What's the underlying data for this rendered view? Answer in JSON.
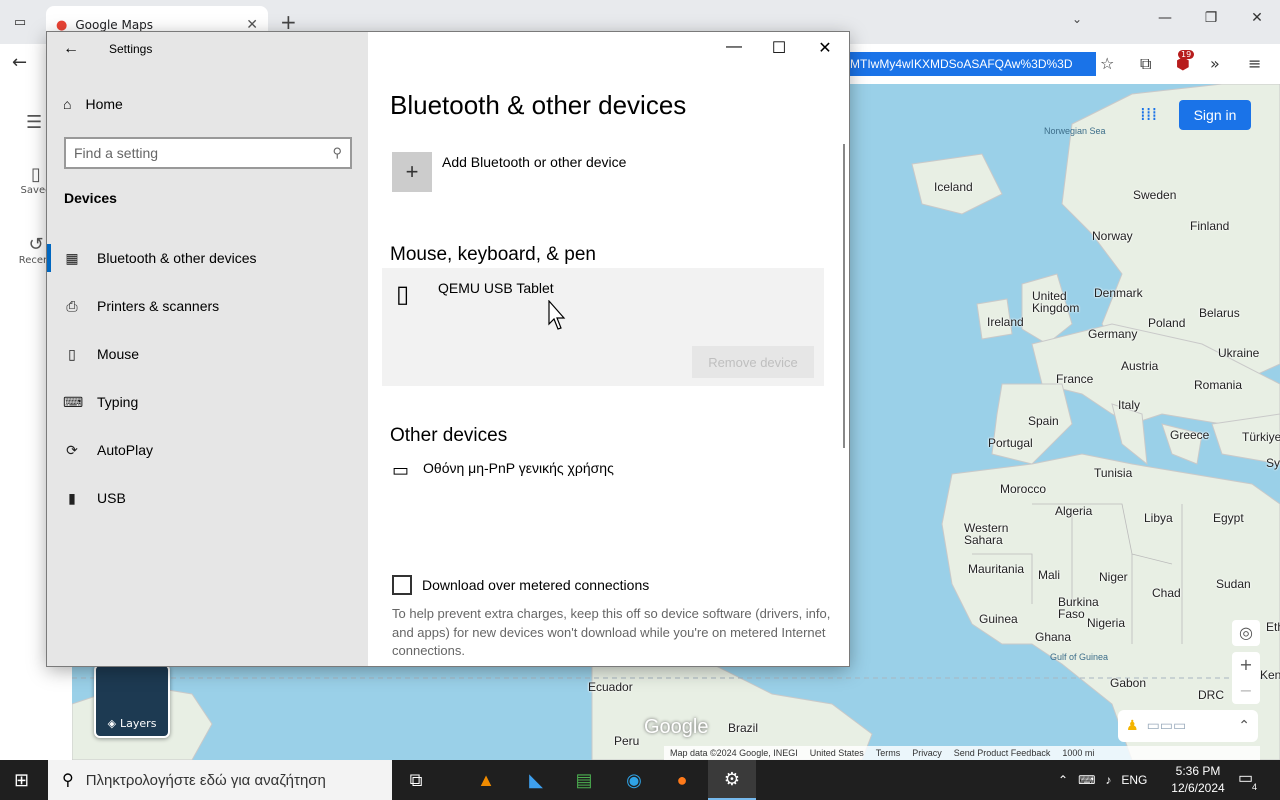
{
  "browser": {
    "tab_title": "Google Maps",
    "url_tail": "MTIwMy4wIKXMDSoASAFQAw%3D%3D",
    "extension_badge": "19"
  },
  "maps": {
    "left_items": [
      "Saved",
      "Recent"
    ],
    "signin_label": "Sign in",
    "layers_label": "Layers",
    "logo": "Google",
    "labels": [
      {
        "text": "Norwegian Sea",
        "sea": true
      },
      {
        "text": "Iceland"
      },
      {
        "text": "Sweden"
      },
      {
        "text": "Finland"
      },
      {
        "text": "Norway"
      },
      {
        "text": "Denmark"
      },
      {
        "text": "United Kingdom"
      },
      {
        "text": "Ireland"
      },
      {
        "text": "Poland"
      },
      {
        "text": "Belarus"
      },
      {
        "text": "Germany"
      },
      {
        "text": "Ukraine"
      },
      {
        "text": "France"
      },
      {
        "text": "Austria"
      },
      {
        "text": "Romania"
      },
      {
        "text": "Italy"
      },
      {
        "text": "Spain"
      },
      {
        "text": "Portugal"
      },
      {
        "text": "Greece"
      },
      {
        "text": "Türkiye"
      },
      {
        "text": "Tunisia"
      },
      {
        "text": "Sy"
      },
      {
        "text": "Morocco"
      },
      {
        "text": "Algeria"
      },
      {
        "text": "Libya"
      },
      {
        "text": "Egypt"
      },
      {
        "text": "Western Sahara"
      },
      {
        "text": "Mauritania"
      },
      {
        "text": "Mali"
      },
      {
        "text": "Niger"
      },
      {
        "text": "Chad"
      },
      {
        "text": "Sudan"
      },
      {
        "text": "Burkina Faso"
      },
      {
        "text": "Guinea"
      },
      {
        "text": "Ghana"
      },
      {
        "text": "Nigeria"
      },
      {
        "text": "Eth"
      },
      {
        "text": "Gulf of Guinea",
        "sea": true
      },
      {
        "text": "Gabon"
      },
      {
        "text": "DRC"
      },
      {
        "text": "Ken"
      },
      {
        "text": "Ecuador"
      },
      {
        "text": "Peru"
      },
      {
        "text": "Brazil"
      }
    ],
    "footer": [
      "Map data ©2024 Google, INEGI",
      "United States",
      "Terms",
      "Privacy",
      "Send Product Feedback",
      "1000 mi"
    ]
  },
  "settings": {
    "window_title": "Settings",
    "home_label": "Home",
    "search_placeholder": "Find a setting",
    "section_label": "Devices",
    "nav": [
      {
        "label": "Bluetooth & other devices",
        "icon": "bluetooth-devices-icon",
        "glyph": "▦",
        "active": true
      },
      {
        "label": "Printers & scanners",
        "icon": "printer-icon",
        "glyph": "⎙",
        "active": false
      },
      {
        "label": "Mouse",
        "icon": "mouse-icon",
        "glyph": "▯",
        "active": false
      },
      {
        "label": "Typing",
        "icon": "keyboard-icon",
        "glyph": "⌨",
        "active": false
      },
      {
        "label": "AutoPlay",
        "icon": "autoplay-icon",
        "glyph": "⟳",
        "active": false
      },
      {
        "label": "USB",
        "icon": "usb-icon",
        "glyph": "▮",
        "active": false
      }
    ],
    "page_title": "Bluetooth & other devices",
    "add_device_label": "Add Bluetooth or other device",
    "mouse_group_title": "Mouse, keyboard, & pen",
    "mouse_device_name": "QEMU USB Tablet",
    "remove_device_label": "Remove device",
    "other_group_title": "Other devices",
    "other_device_name": "Οθόνη μη-PnP γενικής χρήσης",
    "metered_label": "Download over metered connections",
    "metered_help": "To help prevent extra charges, keep this off so device software (drivers, info, and apps) for new devices won't download while you're on metered Internet connections."
  },
  "taskbar": {
    "search_placeholder": "Πληκτρολογήστε εδώ για αναζήτηση",
    "language": "ENG",
    "time": "5:36 PM",
    "date": "12/6/2024",
    "notification_count": "4"
  },
  "colors": {
    "accent": "#0067c0",
    "maps_blue": "#1a73e8",
    "sea": "#9ad0e8",
    "land": "#e8efe4"
  }
}
